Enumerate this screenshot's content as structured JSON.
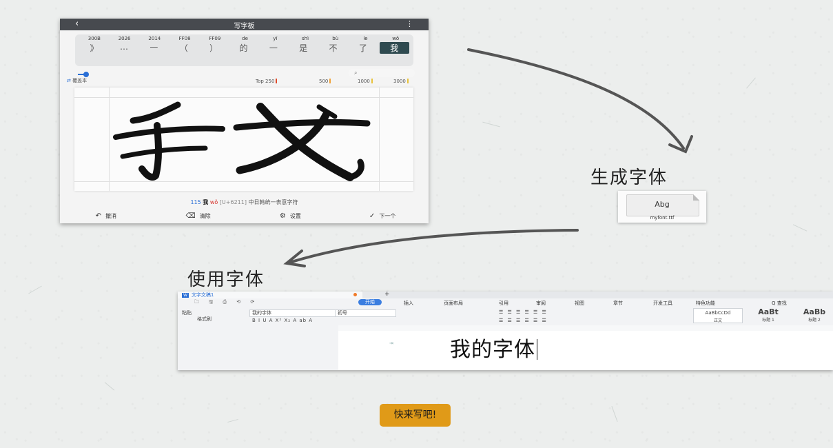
{
  "phone": {
    "title": "写字板",
    "back_icon": "‹",
    "menu_icon": "⋮",
    "codes": [
      "300B",
      "2026",
      "2014",
      "FF08",
      "FF09",
      "de",
      "yī",
      "shì",
      "bù",
      "le",
      "wǒ"
    ],
    "chars": [
      "》",
      "…",
      "—",
      "（",
      "）",
      "的",
      "一",
      "是",
      "不",
      "了",
      "我"
    ],
    "selected_index": 10,
    "search_placeholder": "⌕",
    "mode_label": "覆盖本",
    "levels": [
      "Top 250",
      "500",
      "1000",
      "3000"
    ],
    "canvas_char": "我",
    "info": {
      "num": "115",
      "char": "我",
      "pinyin": "wǒ",
      "unicode": "[U+6211]",
      "desc": "中日韩统一表意字符"
    },
    "toolbar": {
      "undo": "撤消",
      "clear": "清除",
      "settings": "设置",
      "next": "下一个"
    }
  },
  "labels": {
    "generate": "生成字体",
    "use": "使用字体"
  },
  "font_file": {
    "preview": "Abg",
    "filename": "myfont.ttf"
  },
  "wp": {
    "tab_title": "文字文稿1",
    "tab_badge": "W",
    "plus": "+",
    "menu": [
      "开始",
      "插入",
      "页面布局",
      "引用",
      "审阅",
      "视图",
      "章节",
      "开发工具",
      "特色功能",
      "Q 查找"
    ],
    "quick_icons": "🗀 🖫 ⎙ ⟲ ⟳",
    "left_labels": [
      "粘贴",
      "格式刷"
    ],
    "font_name": "我的字体",
    "font_size": "初号",
    "format_row": "B  I  U  A  X²  X₂  A  ab  A",
    "para_row": "☰  ☰  ☰  ☰  ☰  ☰",
    "styles": [
      {
        "big": "AaBbCcDd",
        "sm": "正文"
      },
      {
        "big": "AaBt",
        "sm": "标题 1"
      },
      {
        "big": "AaBb",
        "sm": "标题 2"
      }
    ],
    "doc_text": "我的字体",
    "para_mark": "⇥"
  },
  "cta_label": "快来写吧!"
}
